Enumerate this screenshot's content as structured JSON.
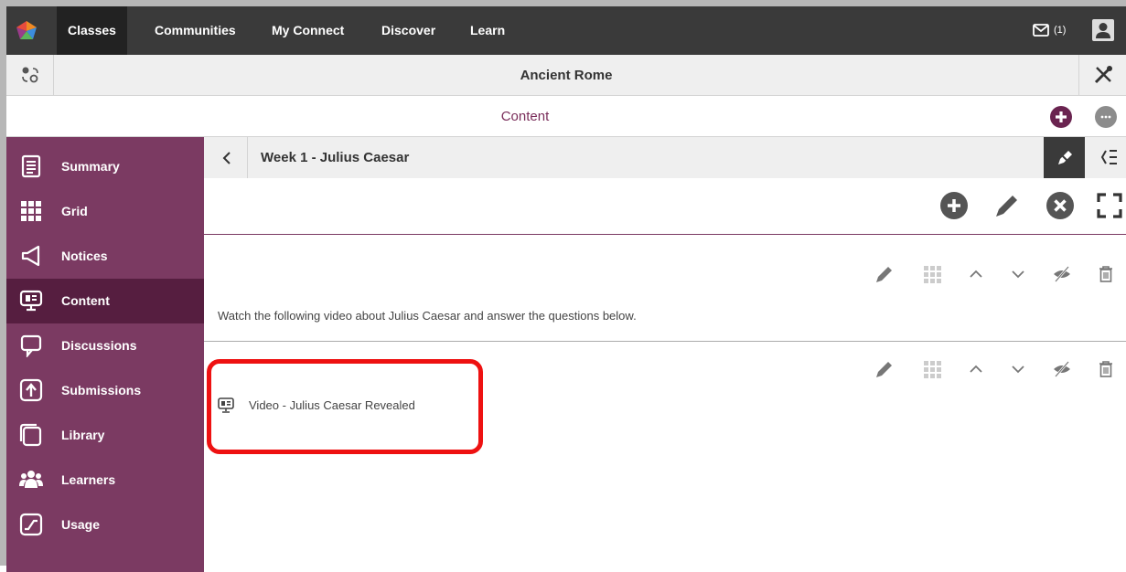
{
  "topnav": {
    "items": [
      {
        "label": "Classes",
        "active": true
      },
      {
        "label": "Communities"
      },
      {
        "label": "My Connect"
      },
      {
        "label": "Discover"
      },
      {
        "label": "Learn"
      }
    ],
    "mail_count": "(1)"
  },
  "classbar": {
    "title": "Ancient Rome"
  },
  "contentbar": {
    "label": "Content"
  },
  "sidebar": {
    "items": [
      {
        "label": "Summary",
        "icon": "summary-icon"
      },
      {
        "label": "Grid",
        "icon": "grid-icon"
      },
      {
        "label": "Notices",
        "icon": "megaphone-icon"
      },
      {
        "label": "Content",
        "icon": "content-icon",
        "active": true
      },
      {
        "label": "Discussions",
        "icon": "discussion-icon"
      },
      {
        "label": "Submissions",
        "icon": "upload-icon"
      },
      {
        "label": "Library",
        "icon": "library-icon"
      },
      {
        "label": "Learners",
        "icon": "people-icon"
      },
      {
        "label": "Usage",
        "icon": "chart-icon"
      }
    ]
  },
  "week": {
    "title": "Week 1 - Julius Caesar"
  },
  "blocks": [
    {
      "text": "Watch the following video about Julius Caesar and answer the questions below."
    },
    {
      "text": "Video - Julius Caesar Revealed"
    }
  ],
  "colors": {
    "brand": "#7b3a62",
    "brand_dark": "#561e40",
    "nav": "#3a3a3a",
    "highlight": "#ee1111"
  }
}
